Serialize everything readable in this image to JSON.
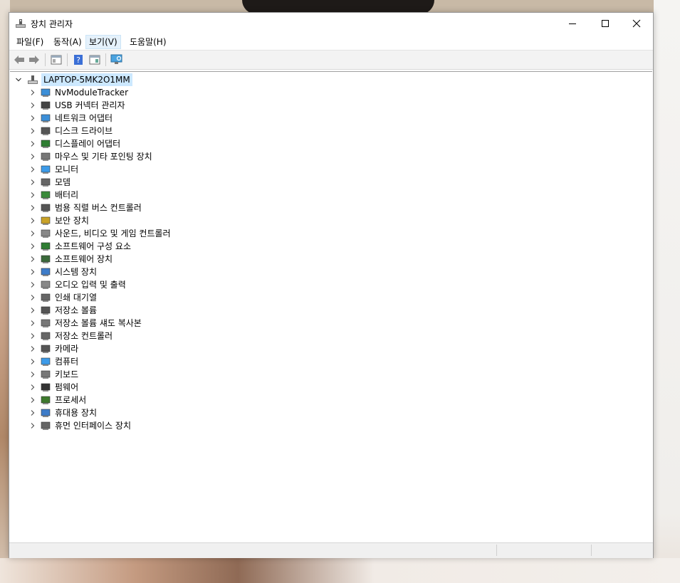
{
  "window": {
    "title": "장치 관리자"
  },
  "menu": [
    {
      "label": "파일(F)"
    },
    {
      "label": "동작(A)"
    },
    {
      "label": "보기(V)"
    },
    {
      "label": "도움말(H)"
    }
  ],
  "tree": {
    "root": "LAPTOP-5MK2O1MM",
    "items": [
      {
        "label": "NvModuleTracker",
        "icon": "network-icon"
      },
      {
        "label": "USB 커넥터 관리자",
        "icon": "usb-icon"
      },
      {
        "label": "네트워크 어댑터",
        "icon": "network-adapter-icon"
      },
      {
        "label": "디스크 드라이브",
        "icon": "disk-drive-icon"
      },
      {
        "label": "디스플레이 어댑터",
        "icon": "display-adapter-icon"
      },
      {
        "label": "마우스 및 기타 포인팅 장치",
        "icon": "mouse-icon"
      },
      {
        "label": "모니터",
        "icon": "monitor-icon"
      },
      {
        "label": "모뎀",
        "icon": "modem-icon"
      },
      {
        "label": "배터리",
        "icon": "battery-icon"
      },
      {
        "label": "범용 직렬 버스 컨트롤러",
        "icon": "usb-controller-icon"
      },
      {
        "label": "보안 장치",
        "icon": "security-device-icon"
      },
      {
        "label": "사운드, 비디오 및 게임 컨트롤러",
        "icon": "speaker-icon"
      },
      {
        "label": "소프트웨어 구성 요소",
        "icon": "software-component-icon"
      },
      {
        "label": "소프트웨어 장치",
        "icon": "software-device-icon"
      },
      {
        "label": "시스템 장치",
        "icon": "system-device-icon"
      },
      {
        "label": "오디오 입력 및 출력",
        "icon": "audio-icon"
      },
      {
        "label": "인쇄 대기열",
        "icon": "printer-icon"
      },
      {
        "label": "저장소 볼륨",
        "icon": "storage-volume-icon"
      },
      {
        "label": "저장소 볼륨 섀도 복사본",
        "icon": "shadow-copy-icon"
      },
      {
        "label": "저장소 컨트롤러",
        "icon": "storage-controller-icon"
      },
      {
        "label": "카메라",
        "icon": "camera-icon"
      },
      {
        "label": "컴퓨터",
        "icon": "computer-icon"
      },
      {
        "label": "키보드",
        "icon": "keyboard-icon"
      },
      {
        "label": "펌웨어",
        "icon": "firmware-icon"
      },
      {
        "label": "프로세서",
        "icon": "processor-icon"
      },
      {
        "label": "휴대용 장치",
        "icon": "portable-device-icon"
      },
      {
        "label": "휴먼 인터페이스 장치",
        "icon": "hid-icon"
      }
    ]
  },
  "toolbar": {
    "buttons": [
      "back-icon",
      "forward-icon",
      "show-hide-console-tree-icon",
      "help-icon",
      "properties-icon",
      "scan-hardware-icon"
    ]
  },
  "colors": {
    "selection": "#cce8ff",
    "menu_active": "#e5f1fb",
    "toolbar_bg": "#f3f3f3",
    "status_bg": "#f0f0f0"
  }
}
